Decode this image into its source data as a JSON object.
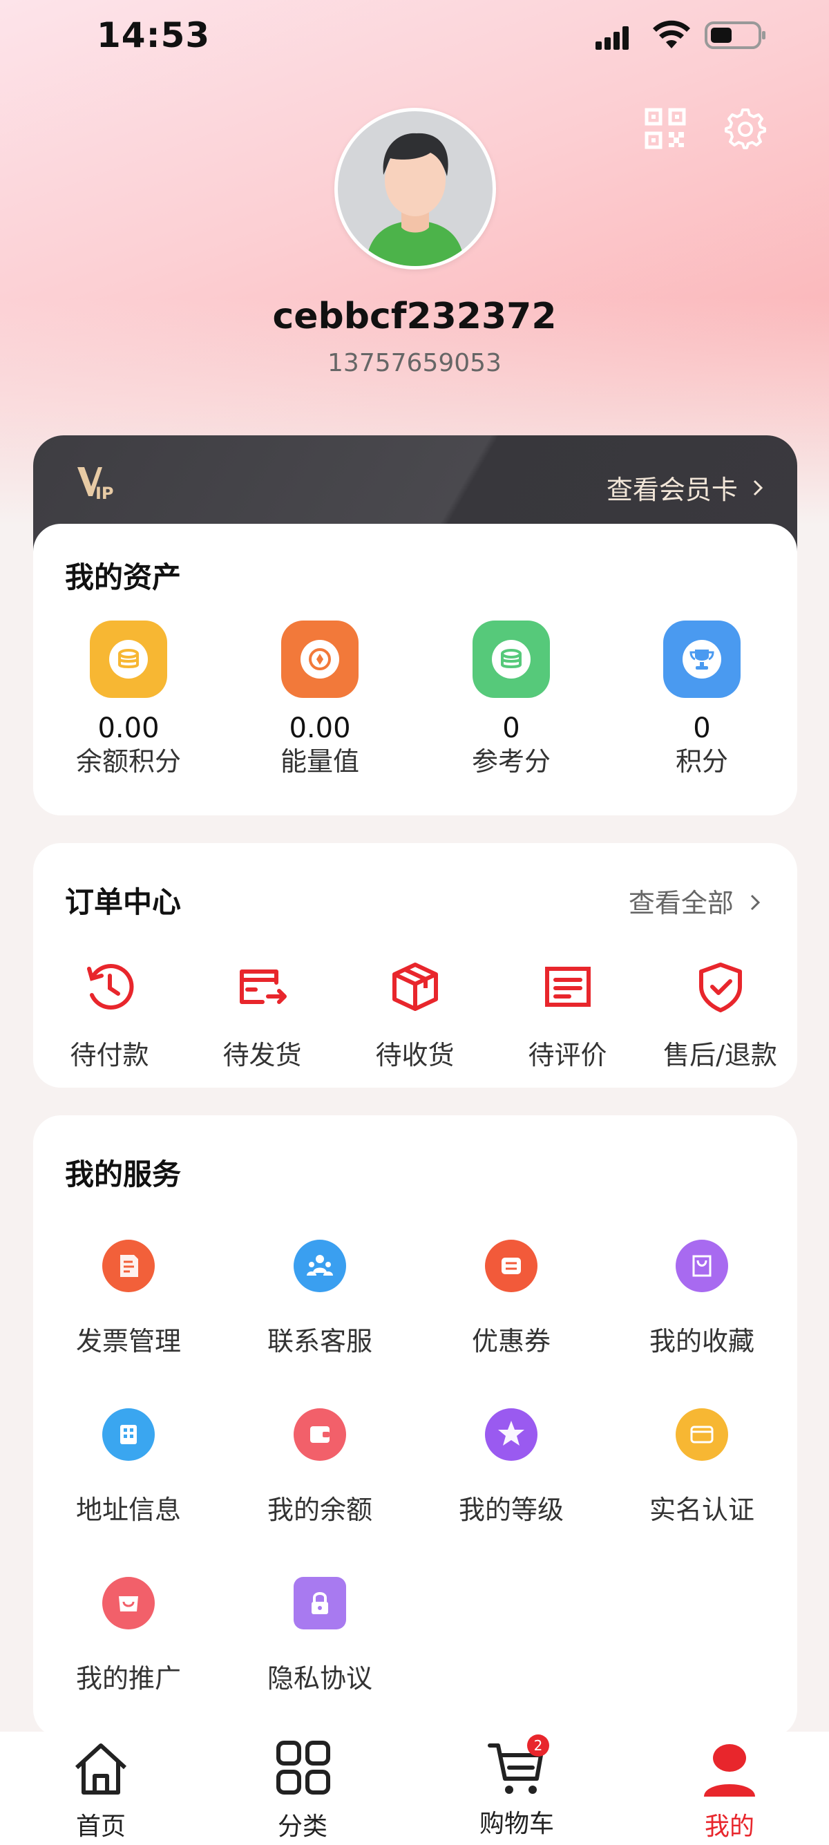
{
  "status_bar": {
    "time": "14:53"
  },
  "profile": {
    "username": "cebbcf232372",
    "phone": "13757659053"
  },
  "vip": {
    "logo_text": "VIP",
    "link_label": "查看会员卡"
  },
  "assets": {
    "title": "我的资产",
    "items": [
      {
        "value": "0.00",
        "label": "余额积分",
        "color": "#f7b733",
        "icon": "coin-stack-icon"
      },
      {
        "value": "0.00",
        "label": "能量值",
        "color": "#f2793a",
        "icon": "energy-coin-icon"
      },
      {
        "value": "0",
        "label": "参考分",
        "color": "#56c97a",
        "icon": "coin-stack-icon"
      },
      {
        "value": "0",
        "label": "积分",
        "color": "#4a9af0",
        "icon": "trophy-icon"
      }
    ]
  },
  "orders": {
    "title": "订单中心",
    "view_all": "查看全部",
    "items": [
      {
        "label": "待付款",
        "icon": "pending-payment-icon"
      },
      {
        "label": "待发货",
        "icon": "pending-shipment-icon"
      },
      {
        "label": "待收货",
        "icon": "package-icon"
      },
      {
        "label": "待评价",
        "icon": "review-icon"
      },
      {
        "label": "售后/退款",
        "icon": "after-sales-shield-icon"
      }
    ],
    "accent": "#e8262c"
  },
  "services": {
    "title": "我的服务",
    "items": [
      {
        "label": "发票管理",
        "icon": "invoice-icon",
        "color": "#f2603a"
      },
      {
        "label": "联系客服",
        "icon": "customer-service-icon",
        "color": "#3a9ff0"
      },
      {
        "label": "优惠券",
        "icon": "coupon-icon",
        "color": "#f25a3a"
      },
      {
        "label": "我的收藏",
        "icon": "favorites-bag-icon",
        "color": "#a86af0"
      },
      {
        "label": "地址信息",
        "icon": "address-icon",
        "color": "#3aa6f0"
      },
      {
        "label": "我的余额",
        "icon": "wallet-icon",
        "color": "#f2606a"
      },
      {
        "label": "我的等级",
        "icon": "vip-level-icon",
        "color": "#9a5af0"
      },
      {
        "label": "实名认证",
        "icon": "id-card-icon",
        "color": "#f7b733"
      },
      {
        "label": "我的推广",
        "icon": "promotion-icon",
        "color": "#f2606a"
      },
      {
        "label": "隐私协议",
        "icon": "lock-icon",
        "color": "#a87af0"
      }
    ]
  },
  "tabbar": {
    "items": [
      {
        "label": "首页",
        "icon": "home-icon",
        "active": false
      },
      {
        "label": "分类",
        "icon": "category-icon",
        "active": false
      },
      {
        "label": "购物车",
        "icon": "cart-icon",
        "active": false,
        "badge": "2"
      },
      {
        "label": "我的",
        "icon": "profile-icon",
        "active": true
      }
    ],
    "active_color": "#e8262c"
  }
}
